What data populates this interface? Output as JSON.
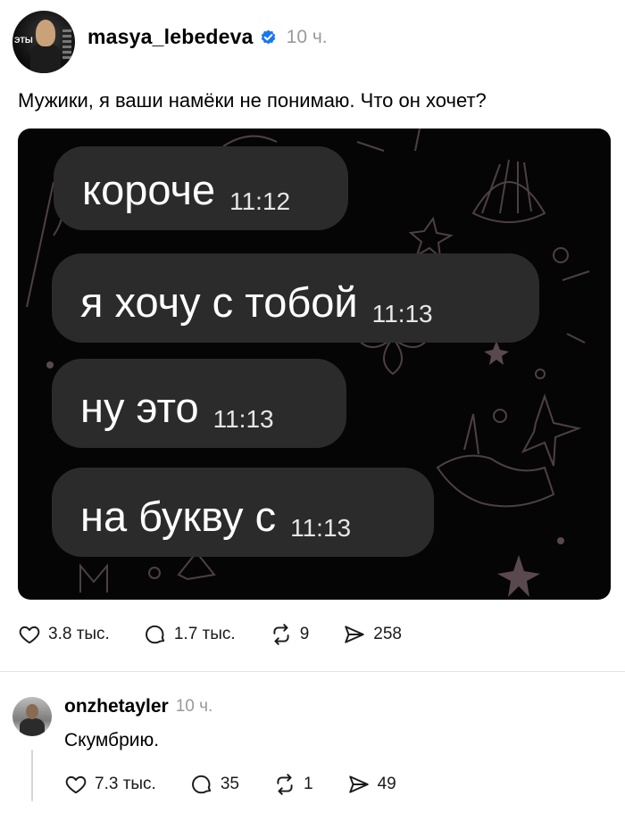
{
  "post": {
    "username": "masya_lebedeva",
    "time": "10 ч.",
    "avatar_tag": "ЭТЫ",
    "text": "Мужики, я ваши намёки не понимаю. Что он хочет?",
    "messages": [
      {
        "text": "короче",
        "time": "11:12"
      },
      {
        "text": "я хочу с тобой",
        "time": "11:13"
      },
      {
        "text": "ну это",
        "time": "11:13"
      },
      {
        "text": "на букву с",
        "time": "11:13"
      }
    ],
    "stats": {
      "likes": "3.8 тыс.",
      "replies": "1.7 тыс.",
      "reposts": "9",
      "shares": "258"
    }
  },
  "comment": {
    "username": "onzhetayler",
    "time": "10 ч.",
    "text": "Скумбрию.",
    "stats": {
      "likes": "7.3 тыс.",
      "replies": "35",
      "reposts": "1",
      "shares": "49"
    }
  },
  "colors": {
    "verified": "#1877f2",
    "muted": "#9a9a9a",
    "bubble": "#2b2b2b",
    "image_bg": "#050505"
  },
  "icons": [
    "verified-badge-icon",
    "heart-icon",
    "comment-icon",
    "repost-icon",
    "share-icon"
  ]
}
